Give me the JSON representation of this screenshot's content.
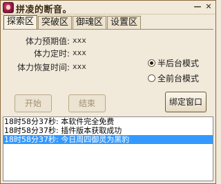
{
  "window": {
    "title": "拼凌的断音。",
    "minimize_label": "—",
    "close_label": "✕"
  },
  "tabs": [
    {
      "label": "探索区",
      "active": true
    },
    {
      "label": "突破区",
      "active": false
    },
    {
      "label": "御魂区",
      "active": false
    },
    {
      "label": "设置区",
      "active": false
    }
  ],
  "stats": [
    {
      "label": "体力预期值:",
      "value": "xxx"
    },
    {
      "label": "体力定时:",
      "value": "xxx"
    },
    {
      "label": "体力恢复时间:",
      "value": "xxx"
    }
  ],
  "modes": [
    {
      "label": "半后台模式",
      "checked": true
    },
    {
      "label": "全前台模式",
      "checked": false
    }
  ],
  "buttons": {
    "start": "开始",
    "stop": "结束",
    "bind": "绑定窗口"
  },
  "log": [
    {
      "text": "18时58分37秒: 本软件完全免费",
      "selected": false
    },
    {
      "text": "18时58分37秒: 插件版本获取成功",
      "selected": false
    },
    {
      "text": "18时58分37秒: 今日周四御灵为黑豹",
      "selected": true
    }
  ]
}
